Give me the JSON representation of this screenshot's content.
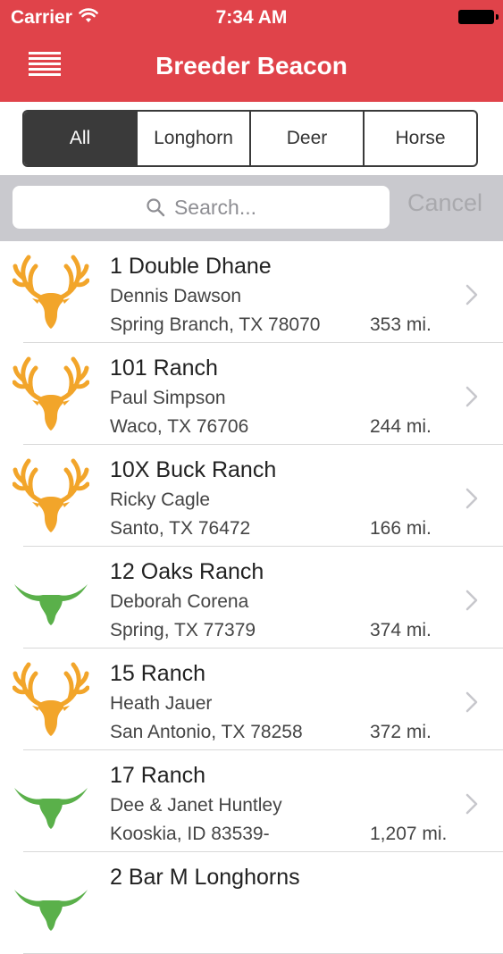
{
  "status": {
    "carrier": "Carrier",
    "time": "7:34 AM"
  },
  "header": {
    "title": "Breeder Beacon"
  },
  "tabs": [
    {
      "label": "All",
      "active": true
    },
    {
      "label": "Longhorn",
      "active": false
    },
    {
      "label": "Deer",
      "active": false
    },
    {
      "label": "Horse",
      "active": false
    }
  ],
  "search": {
    "placeholder": "Search...",
    "cancel": "Cancel"
  },
  "colors": {
    "header": "#e0434a",
    "deer": "#f2a52a",
    "longhorn": "#5ab04a"
  },
  "breeders": [
    {
      "name": "1 Double Dhane",
      "owner": "Dennis Dawson",
      "location": "Spring Branch, TX 78070",
      "distance": "353 mi.",
      "icon": "deer-icon"
    },
    {
      "name": "101 Ranch",
      "owner": "Paul Simpson",
      "location": "Waco, TX 76706",
      "distance": "244 mi.",
      "icon": "deer-icon"
    },
    {
      "name": "10X Buck Ranch",
      "owner": "Ricky Cagle",
      "location": "Santo, TX 76472",
      "distance": "166 mi.",
      "icon": "deer-icon"
    },
    {
      "name": "12 Oaks Ranch",
      "owner": "Deborah Corena",
      "location": "Spring, TX 77379",
      "distance": "374 mi.",
      "icon": "longhorn-icon"
    },
    {
      "name": "15 Ranch",
      "owner": "Heath Jauer",
      "location": "San Antonio, TX 78258",
      "distance": "372 mi.",
      "icon": "deer-icon"
    },
    {
      "name": "17 Ranch",
      "owner": "Dee & Janet Huntley",
      "location": "Kooskia, ID 83539-",
      "distance": "1,207 mi.",
      "icon": "longhorn-icon"
    },
    {
      "name": "2 Bar M Longhorns",
      "owner": "",
      "location": "",
      "distance": "",
      "icon": "longhorn-icon"
    }
  ]
}
